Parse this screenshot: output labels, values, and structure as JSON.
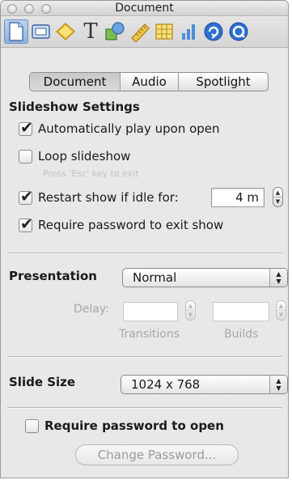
{
  "window": {
    "title": "Document"
  },
  "toolbar": {
    "icons": [
      {
        "name": "document-icon",
        "selected": true
      },
      {
        "name": "slide-icon",
        "selected": false
      },
      {
        "name": "transition-icon",
        "selected": false
      },
      {
        "name": "text-icon",
        "selected": false,
        "glyph": "T"
      },
      {
        "name": "graphic-icon",
        "selected": false
      },
      {
        "name": "metrics-icon",
        "selected": false
      },
      {
        "name": "table-icon",
        "selected": false
      },
      {
        "name": "chart-icon",
        "selected": false
      },
      {
        "name": "hyperlink-icon",
        "selected": false
      },
      {
        "name": "quicktime-icon",
        "selected": false
      }
    ]
  },
  "tabs": {
    "document": "Document",
    "audio": "Audio",
    "spotlight": "Spotlight",
    "active": "Document"
  },
  "slideshow": {
    "title": "Slideshow Settings",
    "autoplay_label": "Automatically play upon open",
    "autoplay_checked": true,
    "loop_label": "Loop slideshow",
    "loop_checked": false,
    "loop_hint": "Press 'Esc' key to exit",
    "restart_label": "Restart show if idle for:",
    "restart_checked": true,
    "restart_value": "4 m",
    "require_exit_label": "Require password to exit show",
    "require_exit_checked": true
  },
  "presentation": {
    "label": "Presentation",
    "selected": "Normal",
    "delay_label": "Delay:",
    "transitions_label": "Transitions",
    "builds_label": "Builds",
    "transitions_value": "",
    "builds_value": ""
  },
  "slide_size": {
    "label": "Slide Size",
    "selected": "1024 x 768"
  },
  "password": {
    "require_open_label": "Require password to open",
    "require_open_checked": false,
    "change_button": "Change Password..."
  },
  "check_mark": "✔",
  "popup_arrows_up": "▲",
  "popup_arrows_down": "▼"
}
